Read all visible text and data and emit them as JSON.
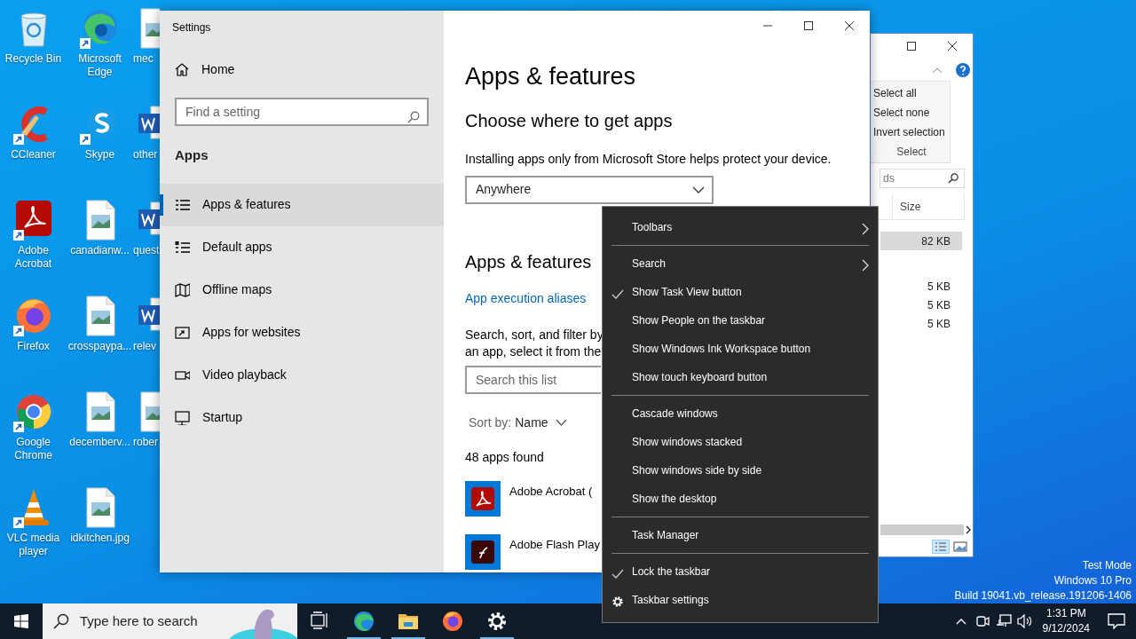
{
  "desktop": {
    "columns": [
      [
        {
          "label": "Recycle Bin",
          "kind": "recycle",
          "shortcut": false
        },
        {
          "label": "CCleaner",
          "kind": "ccleaner",
          "shortcut": true
        },
        {
          "label": "Adobe Acrobat",
          "kind": "acrobat",
          "shortcut": true
        },
        {
          "label": "Firefox",
          "kind": "firefox",
          "shortcut": true
        },
        {
          "label": "Google Chrome",
          "kind": "chrome",
          "shortcut": true
        },
        {
          "label": "VLC media player",
          "kind": "vlc",
          "shortcut": true
        }
      ],
      [
        {
          "label": "Microsoft Edge",
          "kind": "edge",
          "shortcut": true
        },
        {
          "label": "Skype",
          "kind": "skype",
          "shortcut": true
        },
        {
          "label": "canadianw...",
          "kind": "image",
          "shortcut": false
        },
        {
          "label": "crosspaypa...",
          "kind": "image",
          "shortcut": false
        },
        {
          "label": "decemberv...",
          "kind": "image",
          "shortcut": false
        },
        {
          "label": "idkitchen.jpg",
          "kind": "image",
          "shortcut": false
        }
      ],
      [
        {
          "label": "mec",
          "kind": "image",
          "shortcut": false
        },
        {
          "label": "other",
          "kind": "word",
          "shortcut": false
        },
        {
          "label": "quest",
          "kind": "word",
          "shortcut": false
        },
        {
          "label": "relev",
          "kind": "word",
          "shortcut": false
        },
        {
          "label": "rober",
          "kind": "image",
          "shortcut": false
        }
      ]
    ]
  },
  "settings": {
    "title": "Settings",
    "sidebar": {
      "home": "Home",
      "search": {
        "placeholder": "Find a setting"
      },
      "section": "Apps",
      "items": [
        {
          "label": "Apps & features",
          "selected": true
        },
        {
          "label": "Default apps",
          "selected": false
        },
        {
          "label": "Offline maps",
          "selected": false
        },
        {
          "label": "Apps for websites",
          "selected": false
        },
        {
          "label": "Video playback",
          "selected": false
        },
        {
          "label": "Startup",
          "selected": false
        }
      ]
    },
    "page": {
      "title": "Apps & features",
      "subtitle": "Choose where to get apps",
      "description": "Installing apps only from Microsoft Store helps protect your device.",
      "source_dropdown": "Anywhere",
      "section": "Apps & features",
      "link": "App execution aliases",
      "help_lines": [
        "Search, sort, and filter by",
        "an app, select it from the"
      ],
      "search": {
        "placeholder": "Search this list"
      },
      "sort_label": "Sort by:",
      "sort_value": "Name",
      "count": "48 apps found",
      "apps": [
        {
          "name": "Adobe Acrobat (",
          "kind": "acrobat"
        },
        {
          "name": "Adobe Flash Play",
          "kind": "flash"
        }
      ]
    }
  },
  "explorer": {
    "ribbon_items": [
      "Select all",
      "Select none",
      "Invert selection"
    ],
    "ribbon_group": "Select",
    "search": {
      "placeholder": "ds"
    },
    "column": "Size",
    "rows": [
      {
        "size": "82 KB",
        "selected": true
      },
      {
        "size": "5 KB",
        "selected": false
      },
      {
        "size": "5 KB",
        "selected": false
      },
      {
        "size": "5 KB",
        "selected": false
      }
    ]
  },
  "context_menu": {
    "groups": [
      [
        {
          "label": "Toolbars",
          "kind": "submenu"
        }
      ],
      [
        {
          "label": "Search",
          "kind": "submenu"
        },
        {
          "label": "Show Task View button",
          "kind": "toggle",
          "checked": true
        },
        {
          "label": "Show People on the taskbar",
          "kind": "toggle",
          "checked": false
        },
        {
          "label": "Show Windows Ink Workspace button",
          "kind": "toggle",
          "checked": false
        },
        {
          "label": "Show touch keyboard button",
          "kind": "toggle",
          "checked": false
        }
      ],
      [
        {
          "label": "Cascade windows",
          "kind": "command"
        },
        {
          "label": "Show windows stacked",
          "kind": "command"
        },
        {
          "label": "Show windows side by side",
          "kind": "command"
        },
        {
          "label": "Show the desktop",
          "kind": "command"
        }
      ],
      [
        {
          "label": "Task Manager",
          "kind": "command"
        }
      ],
      [
        {
          "label": "Lock the taskbar",
          "kind": "toggle",
          "checked": true
        },
        {
          "label": "Taskbar settings",
          "kind": "settings"
        }
      ]
    ]
  },
  "system_notice": [
    "Test Mode",
    "Windows 10 Pro",
    "Build 19041.vb_release.191206-1406"
  ],
  "taskbar": {
    "search": {
      "placeholder": "Type here to search"
    },
    "apps": [
      {
        "kind": "taskview",
        "running": false
      },
      {
        "kind": "edge",
        "running": true
      },
      {
        "kind": "folder",
        "running": true
      },
      {
        "kind": "firefox",
        "running": false
      },
      {
        "kind": "gear",
        "running": true
      }
    ],
    "time": "1:31 PM",
    "date": "9/12/2024"
  }
}
